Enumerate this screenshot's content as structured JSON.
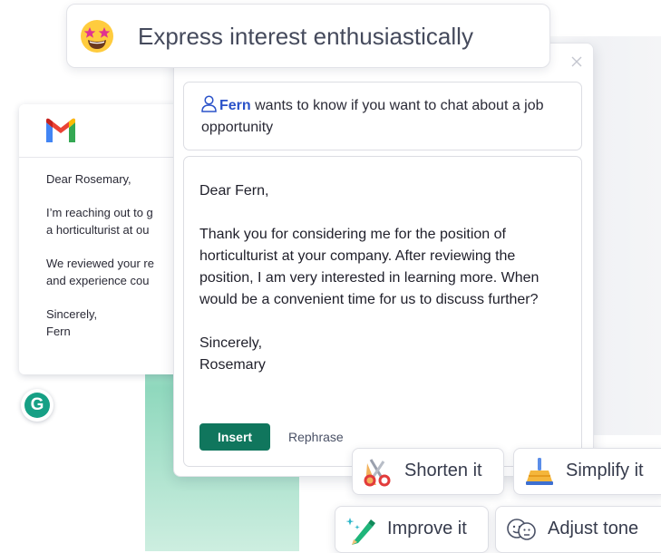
{
  "suggestion": {
    "label": "Express interest enthusiastically",
    "emoji": "star-struck-emoji"
  },
  "email": {
    "app": "Gmail",
    "greeting": "Dear Rosemary,",
    "line1a": "I’m reaching out to g",
    "line1b": "a horticulturist at ou",
    "line2a": "We reviewed your re",
    "line2b": "and experience cou",
    "signoff": "Sincerely,",
    "sender": "Fern"
  },
  "context": {
    "name": "Fern",
    "message": " wants to know if you want to chat about a job opportunity"
  },
  "reply": {
    "greeting": "Dear Fern,",
    "body": "Thank you for considering me for the position of horticulturist at your company. After reviewing the position, I am very interested in learning more. When would be a convenient time for us to discuss further?",
    "signoff": "Sincerely,",
    "name": "Rosemary"
  },
  "actions": {
    "insert": "Insert",
    "rephrase": "Rephrase",
    "shorten": "Shorten it",
    "simplify": "Simplify it",
    "improve": "Improve it",
    "adjust": "Adjust tone"
  },
  "colors": {
    "accent_green": "#10765d",
    "name_blue": "#2a52c9",
    "grammarly_green": "#16a085"
  },
  "icons": {
    "brand": "G"
  }
}
